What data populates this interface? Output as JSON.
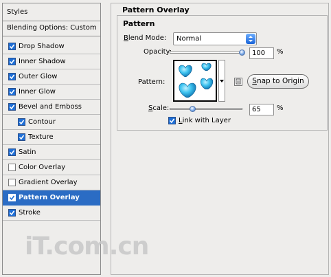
{
  "styles_header": "Styles",
  "blending_options": "Blending Options: Custom",
  "style_items": [
    {
      "label": "Drop Shadow",
      "checked": true,
      "sub": false,
      "selected": false
    },
    {
      "label": "Inner Shadow",
      "checked": true,
      "sub": false,
      "selected": false
    },
    {
      "label": "Outer Glow",
      "checked": true,
      "sub": false,
      "selected": false
    },
    {
      "label": "Inner Glow",
      "checked": true,
      "sub": false,
      "selected": false
    },
    {
      "label": "Bevel and Emboss",
      "checked": true,
      "sub": false,
      "selected": false
    },
    {
      "label": "Contour",
      "checked": true,
      "sub": true,
      "selected": false
    },
    {
      "label": "Texture",
      "checked": true,
      "sub": true,
      "selected": false
    },
    {
      "label": "Satin",
      "checked": true,
      "sub": false,
      "selected": false
    },
    {
      "label": "Color Overlay",
      "checked": false,
      "sub": false,
      "selected": false
    },
    {
      "label": "Gradient Overlay",
      "checked": false,
      "sub": false,
      "selected": false
    },
    {
      "label": "Pattern Overlay",
      "checked": true,
      "sub": false,
      "selected": true
    },
    {
      "label": "Stroke",
      "checked": true,
      "sub": false,
      "selected": false
    }
  ],
  "panel_title": "Pattern Overlay",
  "group_title": "Pattern",
  "blend_mode": {
    "label_pre": "",
    "label_ul": "B",
    "label_post": "lend Mode:",
    "value": "Normal"
  },
  "opacity": {
    "label": "Opacity:",
    "value": "100",
    "unit": "%",
    "fraction": 1.0
  },
  "pattern_label": "Pattern:",
  "snap_button": {
    "ul": "S",
    "rest": "nap to Origin"
  },
  "scale": {
    "label_ul": "S",
    "label_rest": "cale:",
    "value": "65",
    "unit": "%",
    "fraction": 0.32
  },
  "link_layer": {
    "ul": "L",
    "rest": "ink with Layer",
    "checked": true
  },
  "watermark": "iT.com.cn",
  "colors": {
    "selection": "#2b6cc4",
    "heart": "#29b6e8",
    "check": "#1f6fd6"
  }
}
